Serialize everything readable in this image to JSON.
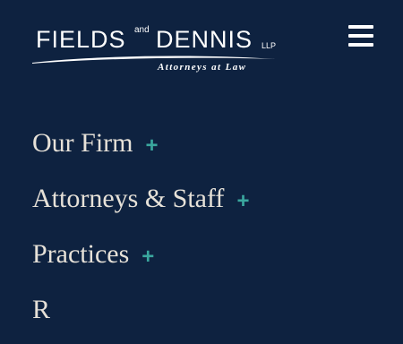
{
  "logo": {
    "word_left": "FIELDS",
    "word_and": "and",
    "word_right": "DENNIS",
    "suffix": "LLP",
    "tagline": "Attorneys at Law"
  },
  "header": {
    "menu_icon": "hamburger-menu-icon"
  },
  "nav": {
    "items": [
      {
        "label": "Our Firm",
        "expand_icon": "+"
      },
      {
        "label": "Attorneys & Staff",
        "expand_icon": "+"
      },
      {
        "label": "Practices",
        "expand_icon": "+"
      },
      {
        "label": "R",
        "expand_icon": ""
      }
    ]
  },
  "colors": {
    "background": "#0e2240",
    "nav_text": "#e6e1d8",
    "accent": "#3aa79e",
    "logo": "#ffffff"
  }
}
